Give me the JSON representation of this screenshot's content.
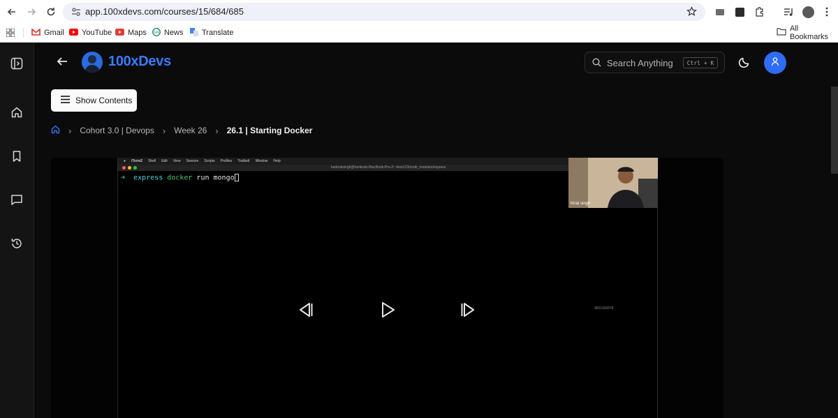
{
  "browser": {
    "url": "app.100xdevs.com/courses/15/684/685",
    "bookmarks": [
      "Gmail",
      "YouTube",
      "Maps",
      "News",
      "Translate"
    ],
    "all_bookmarks": "All Bookmarks"
  },
  "header": {
    "logo_text": "100xDevs",
    "search_placeholder": "Search Anything",
    "search_shortcut": "Ctrl + K"
  },
  "toolbar": {
    "show_contents_label": "Show Contents"
  },
  "breadcrumb": {
    "items": [
      "Cohort 3.0 | Devops",
      "Week 26"
    ],
    "current": "26.1 | Starting Docker"
  },
  "video": {
    "menubar_items": [
      "iTerm2",
      "Shell",
      "Edit",
      "View",
      "Session",
      "Scripts",
      "Profiles",
      "Toolbelt",
      "Window",
      "Help"
    ],
    "terminal_title": "harkiratsingh@harkirats-MacBook-Pro-2:~/test123/node_modules/express",
    "prompt_arrow": "➜",
    "prompt_dir": "express",
    "command": "docker",
    "command_args": "run mongo",
    "webcam_label": "Kirat singh",
    "phone_watermark": "9821169378"
  },
  "colors": {
    "accent": "#3b7bff",
    "background": "#0b0b0b",
    "sidebar": "#141414"
  }
}
